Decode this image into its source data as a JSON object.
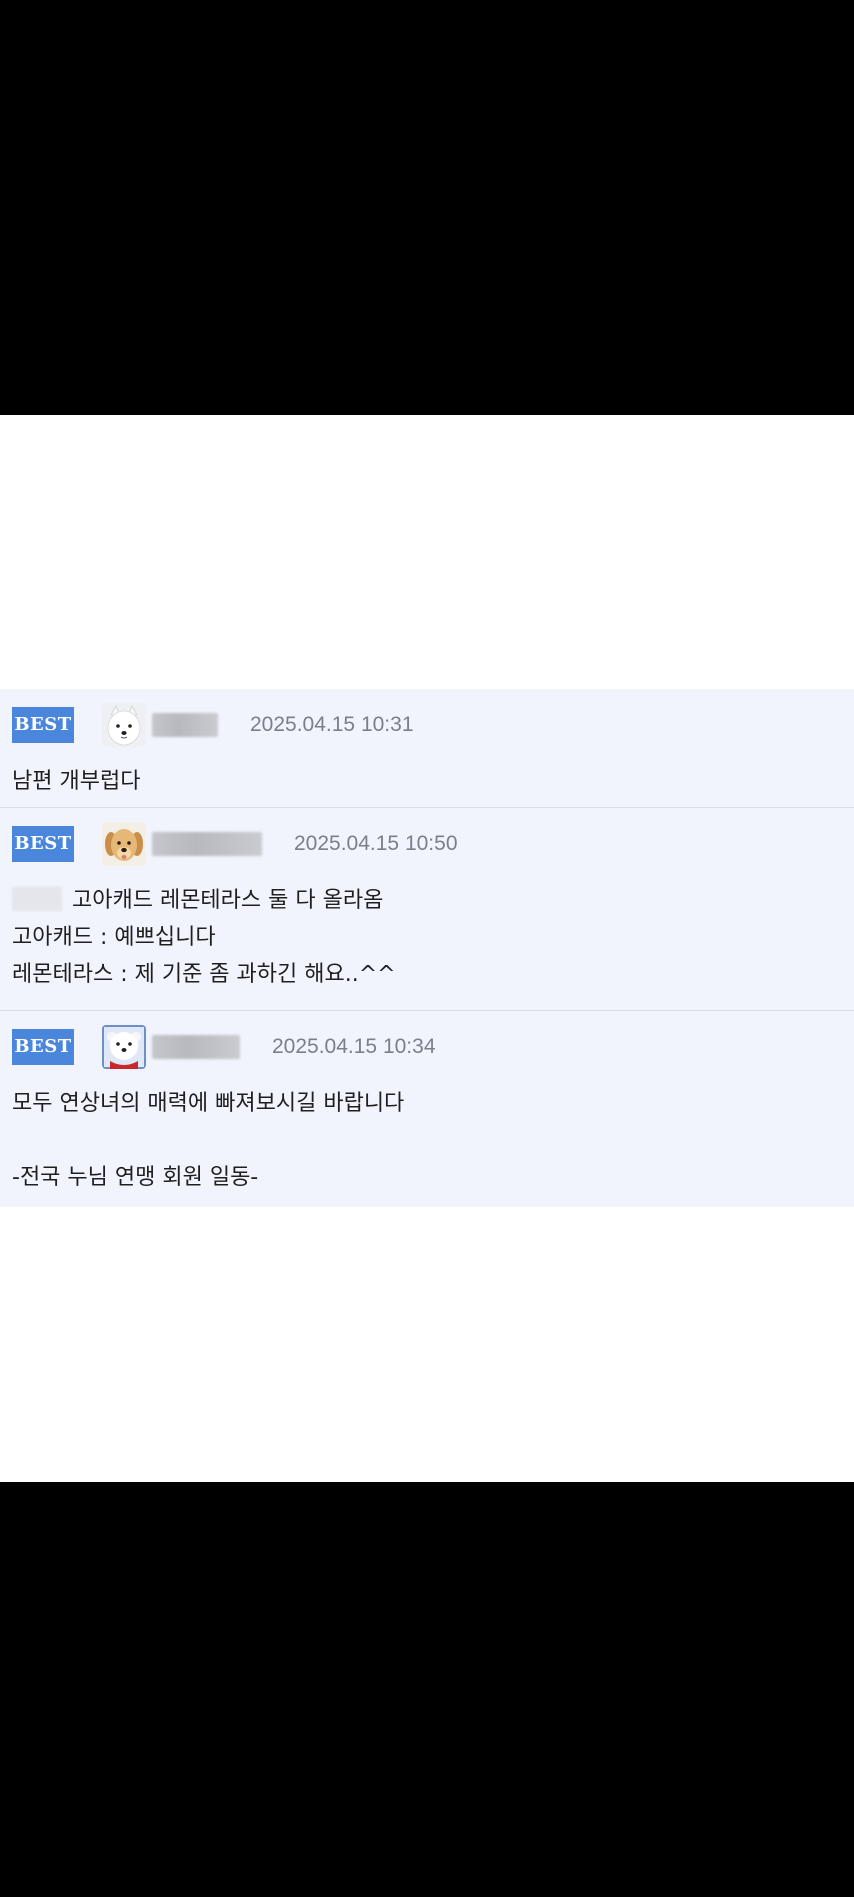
{
  "comments": [
    {
      "badge": "BEST",
      "avatar_icon": "samoyed-avatar-icon",
      "date": "2025.04.15",
      "time": "10:31",
      "lines": [
        "남편 개부럽다"
      ]
    },
    {
      "badge": "BEST",
      "avatar_icon": "golden-retriever-avatar-icon",
      "date": "2025.04.15",
      "time": "10:50",
      "lines": [
        "고아캐드 레몬테라스 둘 다 올라옴",
        "고아캐드 : 예쁘십니다",
        "레몬테라스 : 제 기준 좀 과하긴 해요..^^"
      ]
    },
    {
      "badge": "BEST",
      "avatar_icon": "white-puppy-red-collar-avatar-icon",
      "date": "2025.04.15",
      "time": "10:34",
      "lines": [
        "모두 연상녀의 매력에 빠져보시길 바랍니다",
        "",
        "-전국 누님 연맹 회원 일동-"
      ]
    }
  ],
  "colors": {
    "badge_bg": "#4a86dc",
    "list_bg": "#f1f4fd",
    "date_text": "#7a7f88",
    "body_text": "#1f1f1f",
    "letterbox": "#000000"
  }
}
